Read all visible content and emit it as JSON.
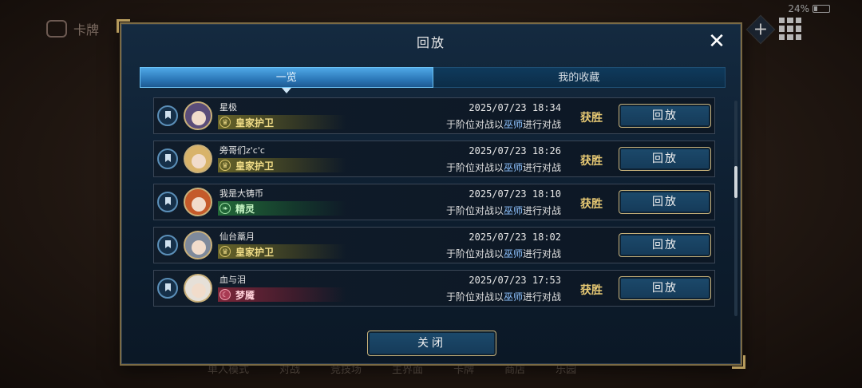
{
  "background": {
    "top_left_label": "卡牌",
    "battery": "24%",
    "nav": [
      "单人模式",
      "对战",
      "竞技场",
      "主界面",
      "卡牌",
      "商店",
      "乐园"
    ]
  },
  "dialog": {
    "title": "回放",
    "close_label": "关闭",
    "tabs": [
      {
        "label": "一览",
        "active": true
      },
      {
        "label": "我的收藏",
        "active": false
      }
    ],
    "matches": [
      {
        "player": "星极",
        "class": "皇家护卫",
        "class_type": "royal",
        "datetime": "2025/07/23  18:34",
        "desc_prefix": "于阶位对战以",
        "desc_class": "巫师",
        "desc_suffix": "进行对战",
        "result": "获胜",
        "replay_label": "回放",
        "avatar_color": "#5a4d7a"
      },
      {
        "player": "旁哥们z'c'c",
        "class": "皇家护卫",
        "class_type": "royal",
        "datetime": "2025/07/23  18:26",
        "desc_prefix": "于阶位对战以",
        "desc_class": "巫师",
        "desc_suffix": "进行对战",
        "result": "获胜",
        "replay_label": "回放",
        "avatar_color": "#d8b36a"
      },
      {
        "player": "我是大铸币",
        "class": "精灵",
        "class_type": "elf",
        "datetime": "2025/07/23  18:10",
        "desc_prefix": "于阶位对战以",
        "desc_class": "巫师",
        "desc_suffix": "进行对战",
        "result": "获胜",
        "replay_label": "回放",
        "avatar_color": "#c45a2a"
      },
      {
        "player": "仙台藁月",
        "class": "皇家护卫",
        "class_type": "royal",
        "datetime": "2025/07/23  18:02",
        "desc_prefix": "于阶位对战以",
        "desc_class": "巫师",
        "desc_suffix": "进行对战",
        "result": "",
        "replay_label": "回放",
        "avatar_color": "#7e8a9c"
      },
      {
        "player": "血与泪",
        "class": "梦魇",
        "class_type": "night",
        "datetime": "2025/07/23  17:53",
        "desc_prefix": "于阶位对战以",
        "desc_class": "巫师",
        "desc_suffix": "进行对战",
        "result": "获胜",
        "replay_label": "回放",
        "avatar_color": "#e6e0d8"
      }
    ]
  }
}
